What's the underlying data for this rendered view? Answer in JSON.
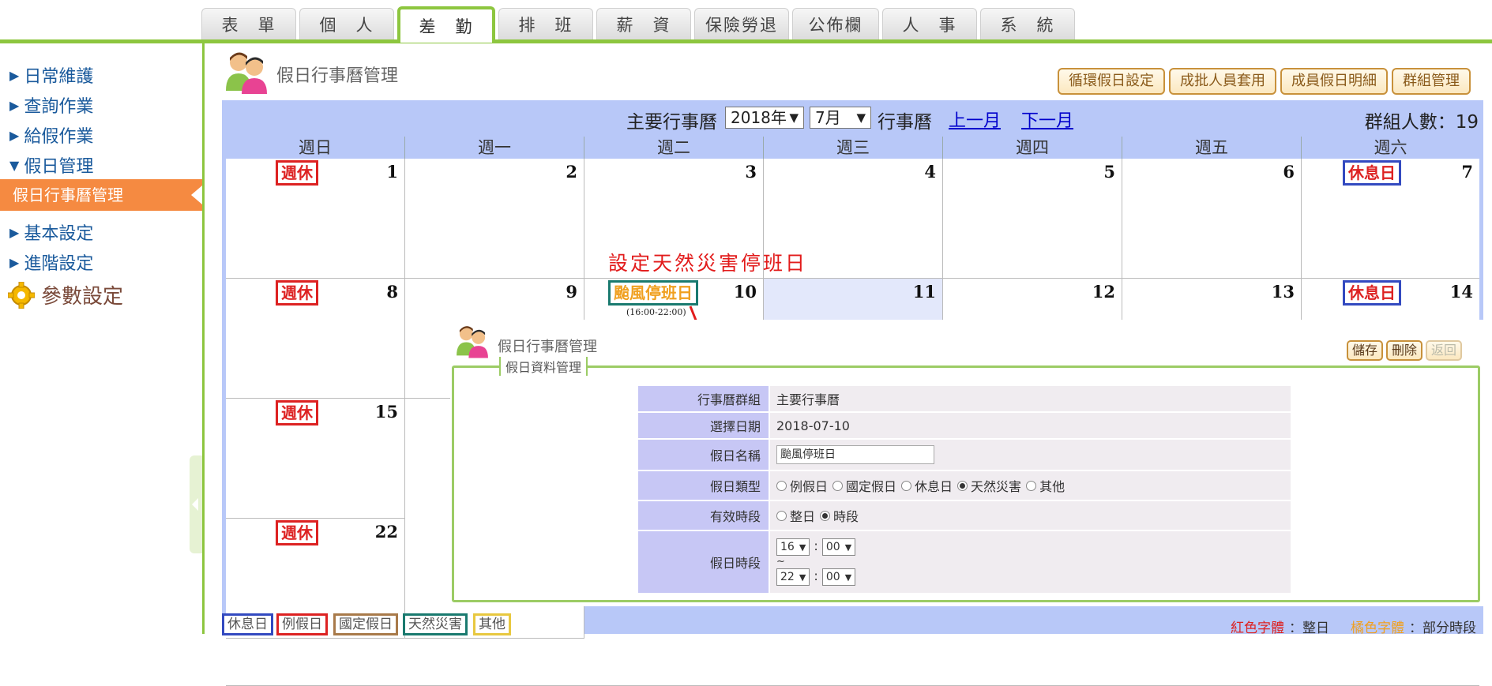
{
  "tabs": [
    "表　單",
    "個　人",
    "差　勤",
    "排　班",
    "薪　資",
    "保險勞退",
    "公佈欄",
    "人　事",
    "系　統"
  ],
  "active_tab": "差　勤",
  "sidebar": {
    "items": [
      "日常維護",
      "查詢作業",
      "給假作業",
      "假日管理"
    ],
    "active": "假日行事曆管理",
    "items2": [
      "基本設定",
      "進階設定"
    ],
    "param": "參數設定"
  },
  "header": {
    "title": "假日行事曆管理",
    "buttons": [
      "循環假日設定",
      "成批人員套用",
      "成員假日明細",
      "群組管理"
    ]
  },
  "calendar": {
    "label": "主要行事曆",
    "year": "2018年",
    "month": "7月",
    "label2": "行事曆",
    "prev": "上一月",
    "next": "下一月",
    "group_count": "群組人數：19",
    "weekdays": [
      "週日",
      "週一",
      "週二",
      "週三",
      "週四",
      "週五",
      "週六"
    ],
    "weeks": [
      [
        "1",
        "2",
        "3",
        "4",
        "5",
        "6",
        "7"
      ],
      [
        "8",
        "9",
        "10",
        "11",
        "12",
        "13",
        "14"
      ],
      [
        "15"
      ],
      [
        "22"
      ]
    ],
    "badge_weekly": "週休",
    "badge_rest": "休息日",
    "badge_typhoon": "颱風停班日",
    "typhoon_time": "(16:00-22:00)"
  },
  "annotation": "設定天然災害停班日",
  "popup": {
    "title": "假日行事曆管理",
    "buttons": [
      "儲存",
      "刪除",
      "返回"
    ],
    "legend": "假日資料管理",
    "rows": {
      "group_label": "行事曆群組",
      "group_value": "主要行事曆",
      "date_label": "選擇日期",
      "date_value": "2018-07-10",
      "name_label": "假日名稱",
      "name_value": "颱風停班日",
      "type_label": "假日類型",
      "types": [
        "例假日",
        "國定假日",
        "休息日",
        "天然災害",
        "其他"
      ],
      "type_selected": "天然災害",
      "period_label": "有效時段",
      "periods": [
        "整日",
        "時段"
      ],
      "period_selected": "時段",
      "time_label": "假日時段",
      "start_hour": "16",
      "start_min": "00",
      "tilde": "~",
      "end_hour": "22",
      "end_min": "00",
      "colon": ":"
    }
  },
  "legend": [
    "休息日",
    "例假日",
    "國定假日",
    "天然災害",
    "其他"
  ],
  "legend_colors": [
    "#334ac0",
    "#d22",
    "#a87a4a",
    "#1a7a6f",
    "#e8c840"
  ],
  "notes": {
    "red_label": "紅色字體",
    "red_text": "：整日",
    "orange_label": "橘色字體",
    "orange_text": "：部分時段"
  }
}
